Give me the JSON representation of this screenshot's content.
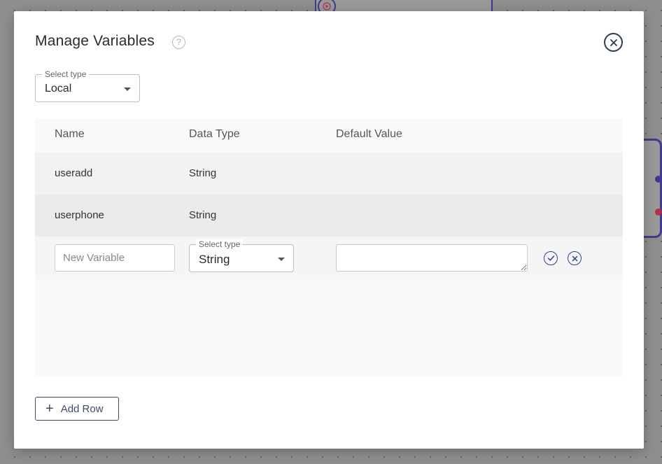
{
  "modal": {
    "title": "Manage Variables",
    "help_icon": "help-circle-icon",
    "close_icon": "close-circle-icon"
  },
  "type_select": {
    "label": "Select type",
    "value": "Local"
  },
  "table": {
    "headers": [
      "Name",
      "Data Type",
      "Default Value"
    ],
    "rows": [
      {
        "name": "useradd",
        "data_type": "String",
        "default_value": ""
      },
      {
        "name": "userphone",
        "data_type": "String",
        "default_value": ""
      }
    ],
    "new_row": {
      "name_placeholder": "New Variable",
      "name_value": "",
      "type_label": "Select type",
      "type_value": "String",
      "default_value": "",
      "confirm_icon": "check-circle-icon",
      "cancel_icon": "close-circle-icon"
    }
  },
  "add_row": {
    "label": "Add Row",
    "icon": "plus-icon"
  },
  "colors": {
    "accent": "#2c3e8f",
    "canvas_node": "#3f3a8f",
    "row_even": "#ebebeb",
    "row_odd": "#f2f2f2"
  }
}
